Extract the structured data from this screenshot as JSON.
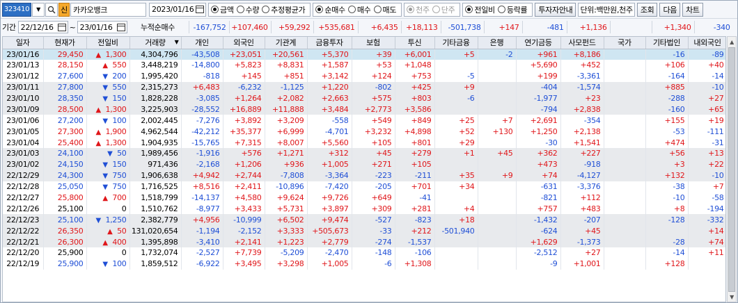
{
  "toolbar": {
    "code": "323410",
    "new_badge": "신",
    "stock_name": "카카오뱅크",
    "date": "2023/01/16",
    "radios1": [
      "금액",
      "수량",
      "추정평균가"
    ],
    "radios2": [
      "순매수",
      "매수",
      "매도"
    ],
    "radios3": [
      "천주",
      "단주"
    ],
    "radios4": [
      "전일비",
      "등락률"
    ],
    "investor_btn": "투자자안내",
    "unit_text": "단위:백만원,천주",
    "query_btn": "조회",
    "next_btn": "다음",
    "chart_btn": "차트"
  },
  "period": {
    "label": "기간",
    "from": "22/12/16",
    "tilde": "~",
    "to": "23/01/16",
    "sum_label": "누적순매수",
    "sums": [
      "-167,752",
      "+107,460",
      "+59,292",
      "+535,681",
      "+6,435",
      "+18,113",
      "-501,738",
      "+147",
      "-481",
      "+1,136",
      "",
      "+1,340",
      "-340"
    ]
  },
  "columns": [
    "일자",
    "현재가",
    "전일비",
    "거래량",
    "개인",
    "외국인",
    "기관계",
    "금융투자",
    "보험",
    "투신",
    "기타금융",
    "은행",
    "연기금등",
    "사모펀드",
    "국가",
    "기타법인",
    "내외국인"
  ],
  "rows": [
    {
      "d": "23/01/16",
      "p": "29,450",
      "dir": "up",
      "chg": "1,300",
      "vol": "4,304,796",
      "v": [
        "-43,508",
        "+23,051",
        "+20,561",
        "+5,370",
        "+39",
        "+6,001",
        "+5",
        "-2",
        "+961",
        "+8,186",
        "",
        "-16",
        "-89"
      ]
    },
    {
      "d": "23/01/13",
      "p": "28,150",
      "dir": "up",
      "chg": "550",
      "vol": "3,448,219",
      "v": [
        "-14,800",
        "+5,823",
        "+8,831",
        "+1,587",
        "+53",
        "+1,048",
        "",
        "",
        "+5,690",
        "+452",
        "",
        "+106",
        "+40"
      ]
    },
    {
      "d": "23/01/12",
      "p": "27,600",
      "dir": "dn",
      "chg": "200",
      "vol": "1,995,420",
      "v": [
        "-818",
        "+145",
        "+851",
        "+3,142",
        "+124",
        "+753",
        "-5",
        "",
        "+199",
        "-3,361",
        "",
        "-164",
        "-14"
      ]
    },
    {
      "d": "23/01/11",
      "p": "27,800",
      "dir": "dn",
      "chg": "550",
      "vol": "2,315,273",
      "v": [
        "+6,483",
        "-6,232",
        "-1,125",
        "+1,220",
        "-802",
        "+425",
        "+9",
        "",
        "-404",
        "-1,574",
        "",
        "+885",
        "-10"
      ]
    },
    {
      "d": "23/01/10",
      "p": "28,350",
      "dir": "dn",
      "chg": "150",
      "vol": "1,828,228",
      "v": [
        "-3,085",
        "+1,264",
        "+2,082",
        "+2,663",
        "+575",
        "+803",
        "-6",
        "",
        "-1,977",
        "+23",
        "",
        "-288",
        "+27"
      ]
    },
    {
      "d": "23/01/09",
      "p": "28,500",
      "dir": "up",
      "chg": "1,300",
      "vol": "3,225,903",
      "v": [
        "-28,552",
        "+16,889",
        "+11,888",
        "+3,484",
        "+2,773",
        "+3,586",
        "",
        "",
        "-794",
        "+2,838",
        "",
        "-160",
        "+65"
      ]
    },
    {
      "d": "23/01/06",
      "p": "27,200",
      "dir": "dn",
      "chg": "100",
      "vol": "2,002,445",
      "v": [
        "-7,276",
        "+3,892",
        "+3,209",
        "-558",
        "+549",
        "+849",
        "+25",
        "+7",
        "+2,691",
        "-354",
        "",
        "+155",
        "+19"
      ]
    },
    {
      "d": "23/01/05",
      "p": "27,300",
      "dir": "up",
      "chg": "1,900",
      "vol": "4,962,544",
      "v": [
        "-42,212",
        "+35,377",
        "+6,999",
        "-4,701",
        "+3,232",
        "+4,898",
        "+52",
        "+130",
        "+1,250",
        "+2,138",
        "",
        "-53",
        "-111"
      ]
    },
    {
      "d": "23/01/04",
      "p": "25,400",
      "dir": "up",
      "chg": "1,300",
      "vol": "1,904,935",
      "v": [
        "-15,765",
        "+7,315",
        "+8,007",
        "+5,560",
        "+105",
        "+801",
        "+29",
        "",
        "-30",
        "+1,541",
        "",
        "+474",
        "-31"
      ]
    },
    {
      "d": "23/01/03",
      "p": "24,100",
      "dir": "dn",
      "chg": "50",
      "vol": "1,989,456",
      "v": [
        "-1,916",
        "+576",
        "+1,271",
        "+312",
        "+45",
        "+279",
        "+1",
        "+45",
        "+362",
        "+227",
        "",
        "+56",
        "+13"
      ]
    },
    {
      "d": "23/01/02",
      "p": "24,150",
      "dir": "dn",
      "chg": "150",
      "vol": "971,436",
      "v": [
        "-2,168",
        "+1,206",
        "+936",
        "+1,005",
        "+271",
        "+105",
        "",
        "",
        "+473",
        "-918",
        "",
        "+3",
        "+22"
      ]
    },
    {
      "d": "22/12/29",
      "p": "24,300",
      "dir": "dn",
      "chg": "750",
      "vol": "1,906,638",
      "v": [
        "+4,942",
        "+2,744",
        "-7,808",
        "-3,364",
        "-223",
        "-211",
        "+35",
        "+9",
        "+74",
        "-4,127",
        "",
        "+132",
        "-10"
      ]
    },
    {
      "d": "22/12/28",
      "p": "25,050",
      "dir": "dn",
      "chg": "750",
      "vol": "1,716,525",
      "v": [
        "+8,516",
        "+2,411",
        "-10,896",
        "-7,420",
        "-205",
        "+701",
        "+34",
        "",
        "-631",
        "-3,376",
        "",
        "-38",
        "+7"
      ]
    },
    {
      "d": "22/12/27",
      "p": "25,800",
      "dir": "up",
      "chg": "700",
      "vol": "1,518,799",
      "v": [
        "-14,137",
        "+4,580",
        "+9,624",
        "+9,726",
        "+649",
        "-41",
        "",
        "",
        "-821",
        "+112",
        "",
        "-10",
        "-58"
      ]
    },
    {
      "d": "22/12/26",
      "p": "25,100",
      "dir": "",
      "chg": "0",
      "vol": "1,510,762",
      "v": [
        "-8,977",
        "+3,433",
        "+5,731",
        "+3,897",
        "+309",
        "+281",
        "+4",
        "",
        "+757",
        "+483",
        "",
        "+8",
        "-194"
      ]
    },
    {
      "d": "22/12/23",
      "p": "25,100",
      "dir": "dn",
      "chg": "1,250",
      "vol": "2,382,779",
      "v": [
        "+4,956",
        "-10,999",
        "+6,502",
        "+9,474",
        "-527",
        "-823",
        "+18",
        "",
        "-1,432",
        "-207",
        "",
        "-128",
        "-332"
      ]
    },
    {
      "d": "22/12/22",
      "p": "26,350",
      "dir": "up",
      "chg": "50",
      "vol": "131,020,654",
      "v": [
        "-1,194",
        "-2,152",
        "+3,333",
        "+505,673",
        "-33",
        "+212",
        "-501,940",
        "",
        "-624",
        "+45",
        "",
        "",
        "+14"
      ]
    },
    {
      "d": "22/12/21",
      "p": "26,300",
      "dir": "up",
      "chg": "400",
      "vol": "1,395,898",
      "v": [
        "-3,410",
        "+2,141",
        "+1,223",
        "+2,779",
        "-274",
        "-1,537",
        "",
        "",
        "+1,629",
        "-1,373",
        "",
        "-28",
        "+74"
      ]
    },
    {
      "d": "22/12/20",
      "p": "25,900",
      "dir": "",
      "chg": "0",
      "vol": "1,732,074",
      "v": [
        "-2,527",
        "+7,739",
        "-5,209",
        "-2,470",
        "-148",
        "-106",
        "",
        "",
        "-2,512",
        "+27",
        "",
        "-14",
        "+11"
      ]
    },
    {
      "d": "22/12/19",
      "p": "25,900",
      "dir": "dn",
      "chg": "100",
      "vol": "1,859,512",
      "v": [
        "-6,922",
        "+3,495",
        "+3,298",
        "+1,005",
        "-6",
        "+1,308",
        "",
        "",
        "-9",
        "+1,001",
        "",
        "+128",
        ""
      ]
    }
  ]
}
